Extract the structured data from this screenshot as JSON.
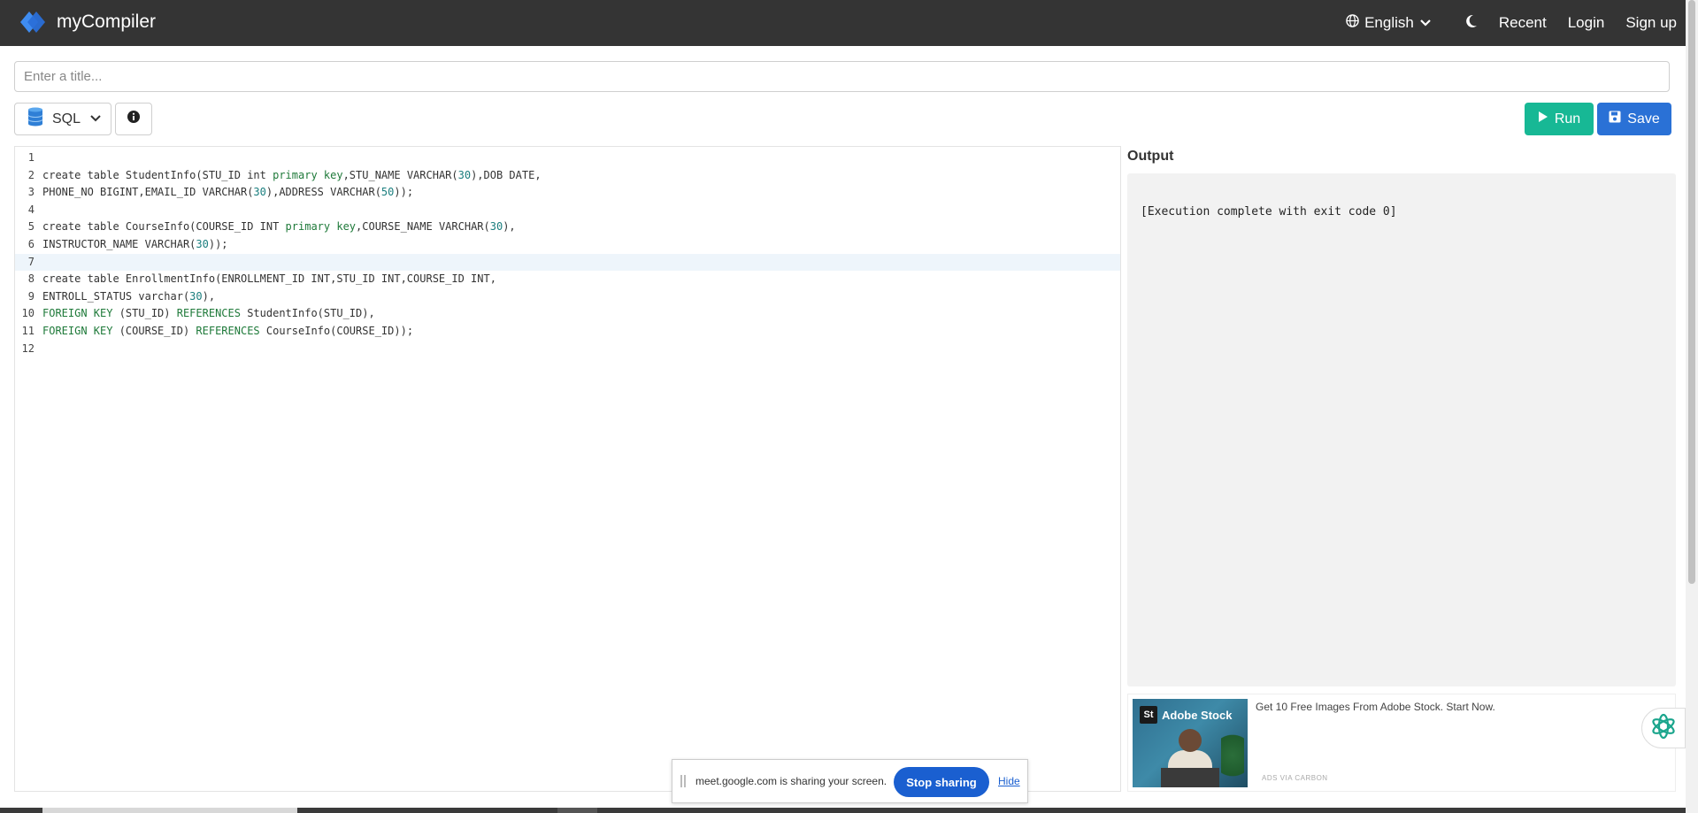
{
  "navbar": {
    "brand": "myCompiler",
    "language": "English",
    "recent": "Recent",
    "login": "Login",
    "signup": "Sign up"
  },
  "title_input": {
    "placeholder": "Enter a title...",
    "value": ""
  },
  "toolbar": {
    "language": "SQL",
    "run_label": "Run",
    "save_label": "Save"
  },
  "editor": {
    "active_line": 7,
    "lines": [
      [],
      [
        [
          "t",
          "create table StudentInfo(STU_ID int "
        ],
        [
          "k",
          "primary key"
        ],
        [
          "t",
          ",STU_NAME VARCHAR("
        ],
        [
          "n",
          "30"
        ],
        [
          "t",
          "),DOB DATE,"
        ]
      ],
      [
        [
          "t",
          "PHONE_NO BIGINT,EMAIL_ID VARCHAR("
        ],
        [
          "n",
          "30"
        ],
        [
          "t",
          "),ADDRESS VARCHAR("
        ],
        [
          "n",
          "50"
        ],
        [
          "t",
          "));"
        ]
      ],
      [],
      [
        [
          "t",
          "create table CourseInfo(COURSE_ID INT "
        ],
        [
          "k",
          "primary key"
        ],
        [
          "t",
          ",COURSE_NAME VARCHAR("
        ],
        [
          "n",
          "30"
        ],
        [
          "t",
          "),"
        ]
      ],
      [
        [
          "t",
          "INSTRUCTOR_NAME VARCHAR("
        ],
        [
          "n",
          "30"
        ],
        [
          "t",
          "));"
        ]
      ],
      [],
      [
        [
          "t",
          "create table EnrollmentInfo(ENROLLMENT_ID INT,STU_ID INT,COURSE_ID INT,"
        ]
      ],
      [
        [
          "t",
          "ENTROLL_STATUS varchar("
        ],
        [
          "n",
          "30"
        ],
        [
          "t",
          "),"
        ]
      ],
      [
        [
          "k",
          "FOREIGN KEY"
        ],
        [
          "t",
          " (STU_ID) "
        ],
        [
          "k",
          "REFERENCES"
        ],
        [
          "t",
          " StudentInfo(STU_ID),"
        ]
      ],
      [
        [
          "k",
          "FOREIGN KEY"
        ],
        [
          "t",
          " (COURSE_ID) "
        ],
        [
          "k",
          "REFERENCES"
        ],
        [
          "t",
          " CourseInfo(COURSE_ID));"
        ]
      ],
      []
    ]
  },
  "output": {
    "title": "Output",
    "text": "[Execution complete with exit code 0]"
  },
  "ad": {
    "brand": "Adobe Stock",
    "logo_mark": "St",
    "text": "Get 10 Free Images From Adobe Stock. Start Now.",
    "via": "ADS VIA CARBON"
  },
  "share_bar": {
    "message": "meet.google.com is sharing your screen.",
    "stop_label": "Stop sharing",
    "hide_label": "Hide"
  },
  "colors": {
    "navbar_bg": "#343434",
    "run_green": "#17b895",
    "save_blue": "#2a71d6",
    "keyword_green": "#1f7a3a",
    "number_teal": "#1a7e7e",
    "stop_blue": "#1a5fd0"
  }
}
